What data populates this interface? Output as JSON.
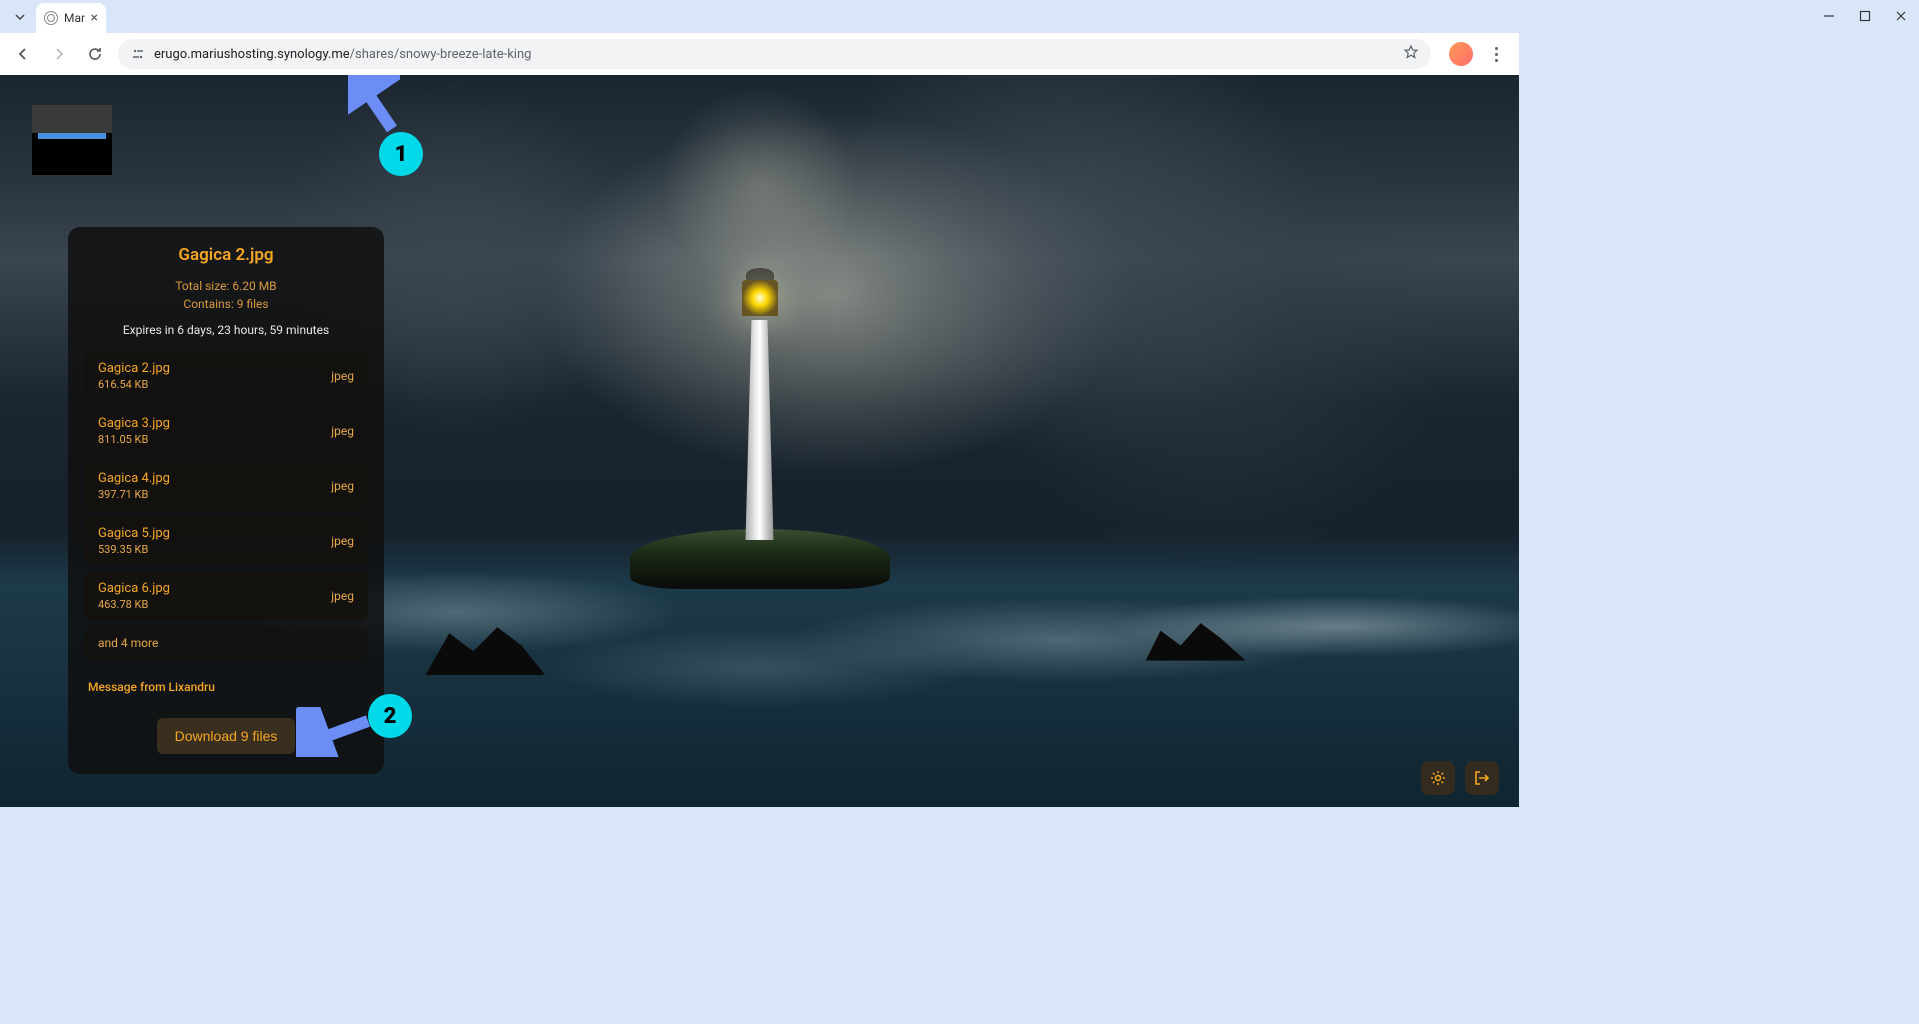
{
  "browser": {
    "tab_title": "Mar",
    "url_domain": "erugo.mariushosting.synology.me",
    "url_path": "/shares/snowy-breeze-late-king"
  },
  "share": {
    "title": "Gagica 2.jpg",
    "total_size": "Total size: 6.20 MB",
    "contains": "Contains: 9 files",
    "expires": "Expires in 6 days, 23 hours, 59 minutes",
    "files": [
      {
        "name": "Gagica 2.jpg",
        "size": "616.54 KB",
        "type": "jpeg"
      },
      {
        "name": "Gagica 3.jpg",
        "size": "811.05 KB",
        "type": "jpeg"
      },
      {
        "name": "Gagica 4.jpg",
        "size": "397.71 KB",
        "type": "jpeg"
      },
      {
        "name": "Gagica 5.jpg",
        "size": "539.35 KB",
        "type": "jpeg"
      },
      {
        "name": "Gagica 6.jpg",
        "size": "463.78 KB",
        "type": "jpeg"
      }
    ],
    "more": "and 4 more",
    "message_from": "Message from Lixandru",
    "download_label": "Download 9 files"
  },
  "annotations": {
    "badge1": "1",
    "badge2": "2"
  }
}
